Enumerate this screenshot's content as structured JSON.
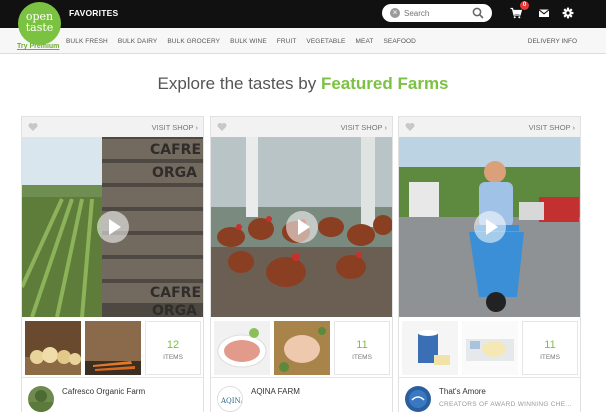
{
  "header": {
    "logo_line1": "open",
    "logo_line2": "taste",
    "favorites_label": "FAVORITES",
    "search": {
      "placeholder": "Search",
      "value": ""
    },
    "cart_count": "0",
    "icons": [
      "cart-icon",
      "mail-icon",
      "gear-icon",
      "search-icon",
      "clear-icon"
    ]
  },
  "nav": {
    "premium_label": "Try Premium",
    "categories": [
      "BULK FRESH",
      "BULK DAIRY",
      "BULK GROCERY",
      "BULK WINE",
      "FRUIT",
      "VEGETABLE",
      "MEAT",
      "SEAFOOD"
    ],
    "delivery_label": "DELIVERY INFO"
  },
  "main": {
    "heading_prefix": "Explore the tastes by ",
    "heading_highlight": "Featured Farms",
    "farms": [
      {
        "visit_label": "VISIT SHOP",
        "count": "12",
        "count_label": "ITEMS",
        "name": "Cafresco Organic Farm",
        "subtitle": ""
      },
      {
        "visit_label": "VISIT SHOP",
        "count": "11",
        "count_label": "ITEMS",
        "name": "AQINA FARM",
        "subtitle": ""
      },
      {
        "visit_label": "VISIT SHOP",
        "count": "11",
        "count_label": "ITEMS",
        "name": "That's Amore",
        "subtitle": "CREATORS OF AWARD WINNING CHE..."
      }
    ]
  },
  "colors": {
    "brand_green": "#7cc242",
    "topbar": "#111111",
    "badge": "#e23b3b"
  }
}
